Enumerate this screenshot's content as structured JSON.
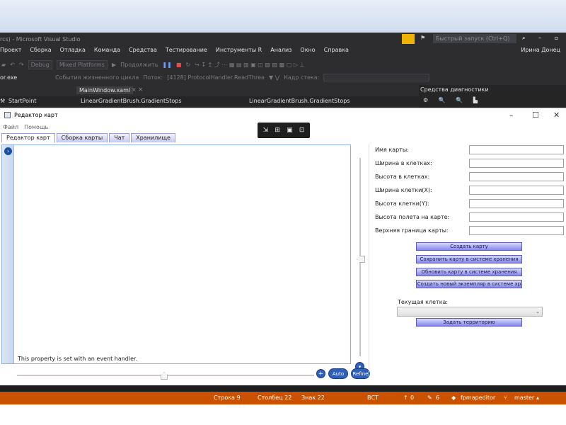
{
  "vs": {
    "title": "rcs) - Microsoft Visual Studio",
    "quick_launch": "Быстрый запуск (Ctrl+Q)",
    "menu": [
      "Проект",
      "Сборка",
      "Отладка",
      "Команда",
      "Средства",
      "Тестирование",
      "Инструменты R",
      "Анализ",
      "Окно",
      "Справка"
    ],
    "account": "Ирина Донец",
    "toolbar": {
      "config": "Debug",
      "platform": "Mixed Platforms",
      "continue": "Продолжить"
    },
    "process": "or.exe",
    "lifecycle": "События жизненного цикла",
    "thread_label": "Поток:",
    "thread": "[4128] ProtocolHandler.ReadThrea",
    "frame_label": "Кадр стека:",
    "tab_doc": "MainWindow.xaml",
    "nav_left": "StartPoint",
    "nav_mid": "LinearGradientBrush.GradientStops",
    "nav_right": "LinearGradientBrush.GradientStops",
    "diag_title": "Средства диагностики"
  },
  "app": {
    "title": "Редактор карт",
    "menu": [
      "Файл",
      "Помощь"
    ],
    "tabs": [
      "Редактор карт",
      "Сборка карты",
      "Чат",
      "Хранилище"
    ],
    "hint": "This property is set with an event handler.",
    "auto": "Auto",
    "refine": "Refine",
    "labels": [
      "Имя карты:",
      "Ширина в клетках:",
      "Высота в клетках:",
      "Ширина клетки(X):",
      "Высота клетки(Y):",
      "Высота полета на карте:",
      "Верхняя граница карты:"
    ],
    "buttons": [
      "Создать карту",
      "Сохранить карту в системе хранения",
      "Обновить карту в системе хранения",
      "Создать новый экземпляр в системе хр"
    ],
    "current_cell": "Текущая клетка:",
    "set_territory": "Задать территорию"
  },
  "status": {
    "row": "Строка 9",
    "col": "Столбец 22",
    "char": "Знак 22",
    "mode": "ВСТ",
    "up": "0",
    "pencil": "6",
    "repo": "fpmapeditor",
    "branch": "master"
  },
  "colors": {
    "vs_bg": "#2d2d30",
    "status": "#ca5100",
    "accent": "#8687ee",
    "debug_pause": "#68a0ff"
  }
}
